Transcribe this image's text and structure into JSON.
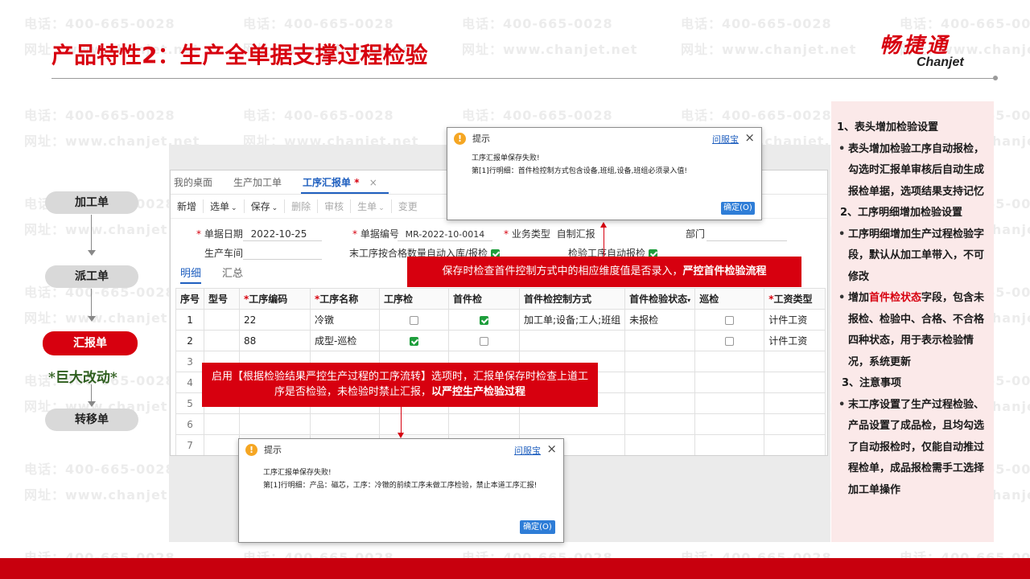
{
  "watermark": {
    "phone": "电话：400-665-0028",
    "site": "网址：www.chanjet.net"
  },
  "header": {
    "title": "产品特性2：生产全单据支撑过程检验",
    "logo_cn": "畅捷通",
    "logo_en": "Chanjet"
  },
  "flow": {
    "steps": [
      "加工单",
      "派工单",
      "汇报单",
      "转移单"
    ],
    "note": "*巨大改动*"
  },
  "app": {
    "tabs": [
      "我的桌面",
      "生产加工单",
      "工序汇报单",
      "*",
      "×"
    ],
    "toolbar": {
      "add": "新增",
      "select": "选单",
      "save": "保存",
      "delete": "删除",
      "audit": "审核",
      "generate": "生单",
      "change": "变更"
    },
    "form": {
      "date_label": "单据日期",
      "date_value": "2022-10-25",
      "no_label": "单据编号",
      "no_value": "MR-2022-10-0014",
      "biz_type_label": "业务类型",
      "biz_type_value": "自制汇报",
      "dept_label": "部门",
      "workshop_label": "生产车间",
      "last_op_label": "末工序按合格数量自动入库/报检",
      "inspect_label": "检验工序自动报检"
    },
    "subtabs": [
      "明细",
      "汇总"
    ],
    "table": {
      "headers": [
        "序号",
        "型号",
        "工序编码",
        "工序名称",
        "工序检",
        "首件检",
        "首件检控制方式",
        "首件检验状态",
        "巡检",
        "工资类型"
      ],
      "rows": [
        {
          "no": "1",
          "model": "",
          "code": "22",
          "name": "冷镦",
          "proc": false,
          "first": true,
          "ctrl": "加工单;设备;工人;班组",
          "status": "未报检",
          "patrol": false,
          "wage": "计件工资"
        },
        {
          "no": "2",
          "model": "",
          "code": "88",
          "name": "成型-巡检",
          "proc": true,
          "first": false,
          "ctrl": "",
          "status": "",
          "patrol": false,
          "wage": "计件工资"
        },
        {
          "no": "3"
        },
        {
          "no": "4"
        },
        {
          "no": "5"
        },
        {
          "no": "6"
        },
        {
          "no": "7"
        }
      ]
    }
  },
  "dialog_top": {
    "title": "提示",
    "help": "问服宝",
    "close": "×",
    "line1": "工序汇报单保存失败!",
    "line2": "第[1]行明细：首件检控制方式包含设备,班组,设备,班组必须录入值!",
    "ok": "确定(O)"
  },
  "dialog_bottom": {
    "title": "提示",
    "help": "问服宝",
    "close": "×",
    "line1": "工序汇报单保存失败!",
    "line2": "第[1]行明细：产品：磁芯，工序：冷镦的前续工序未做工序检验，禁止本道工序汇报!",
    "ok": "确定(O)"
  },
  "callout_top": {
    "text": "保存时检查首件控制方式中的相应维度值是否录入，",
    "emph": "严控首件检验流程"
  },
  "callout_mid": {
    "text": "启用【根据检验结果严控生产过程的工序流转】选项时，汇报单保存时检查上道工序是否检验，未检验时禁止汇报，",
    "emph": "以严控生产检验过程"
  },
  "right_panel": {
    "s1_title": "1、表头增加检验设置",
    "s1_item": "表头增加检验工序自动报检，勾选时汇报单审核后自动生成报检单据，选项结果支持记忆",
    "s2_title": "2、工序明细增加检验设置",
    "s2_item1": "工序明细增加生产过程检验字段，默认从加工单带入，不可修改",
    "s2_item2_a": "增加",
    "s2_item2_red": "首件检状态",
    "s2_item2_b": "字段，包含未报检、检验中、合格、不合格四种状态，用于表示检验情况，系统更新",
    "s3_title": "3、注意事项",
    "s3_item": "末工序设置了生产过程检验、产品设置了成品检，且均勾选了自动报检时，仅能自动推过程检单，成品报检需手工选择加工单操作"
  },
  "colors": {
    "brand_red": "#d7000f",
    "panel_pink": "#fbe9e9",
    "link_blue": "#1f5fbf",
    "check_green": "#1e9e3c"
  }
}
